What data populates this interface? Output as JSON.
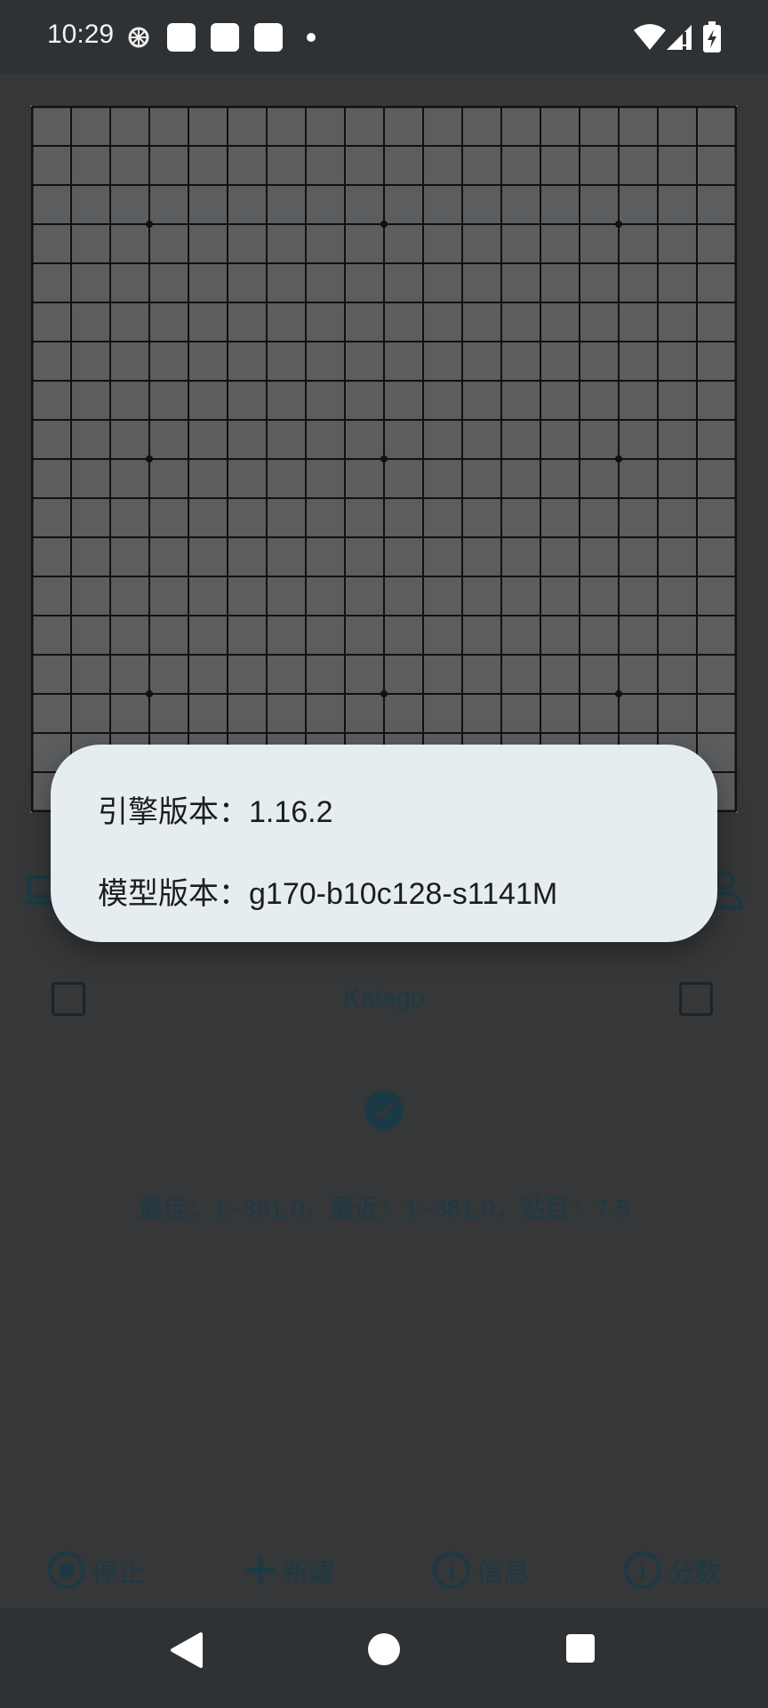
{
  "status_bar": {
    "time": "10:29",
    "icons": [
      "notification-app-icon",
      "notification-square-icon",
      "notification-square-icon",
      "notification-square-icon",
      "dot-icon",
      "wifi-icon",
      "signal-icon",
      "battery-charging-icon"
    ]
  },
  "board": {
    "size": 19,
    "star_points": 9
  },
  "game_panel": {
    "engine_name": "Katago",
    "stats": "最佳：1:-361.0，最近：1:-361.0，贴目：7.5"
  },
  "dialog": {
    "engine_version": "引擎版本：1.16.2",
    "model_version": "模型版本：g170-b10c128-s1141M"
  },
  "bottom_bar": {
    "stop_label": "停止",
    "new_label": "新建",
    "info_label": "信息",
    "score_label": "分数"
  },
  "colors": {
    "dialog_bg": "#e6edf0",
    "accent_dim": "#1c3a45"
  }
}
